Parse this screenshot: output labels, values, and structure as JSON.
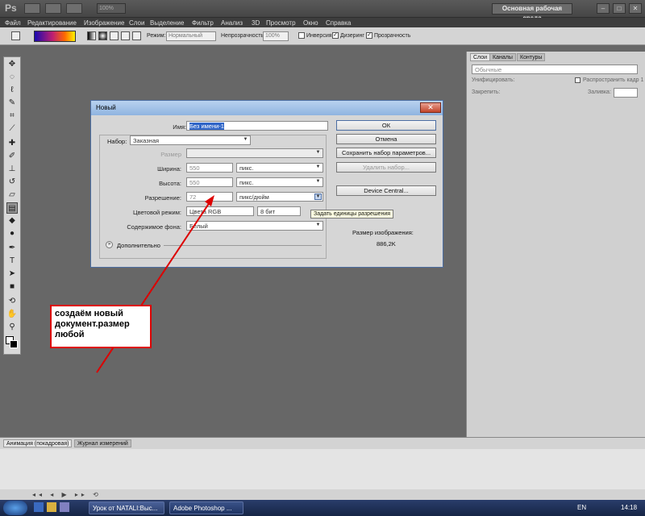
{
  "app": {
    "logo": "Ps",
    "zoom": "100%",
    "workspace": "Основная рабочая среда"
  },
  "menu": [
    "Файл",
    "Редактирование",
    "Изображение",
    "Слои",
    "Выделение",
    "Фильтр",
    "Анализ",
    "3D",
    "Просмотр",
    "Окно",
    "Справка"
  ],
  "window_controls": [
    "–",
    "□",
    "✕"
  ],
  "options": {
    "mode_label": "Режим:",
    "mode_value": "Нормальный",
    "opacity_label": "Непрозрачность:",
    "opacity_value": "100%",
    "invert": "Инверсия",
    "dither": "Дизеринг",
    "transparency": "Прозрачность"
  },
  "panel": {
    "tabs": [
      "Слои",
      "Каналы",
      "Контуры"
    ],
    "blend": "Обычные",
    "unify": "Унифицировать:",
    "propagate": "Распространить кадр 1",
    "lock": "Закрепить:",
    "fill": "Заливка:"
  },
  "bottom": {
    "tabs": [
      "Анимация (покадровая)",
      "Журнал измерений"
    ]
  },
  "dialog": {
    "title": "Новый",
    "name_label": "Имя:",
    "name_value": "Без имени-1",
    "preset_label": "Набор:",
    "preset_value": "Заказная",
    "size_label": "Размер",
    "width_label": "Ширина:",
    "width_value": "550",
    "width_unit": "пикс.",
    "height_label": "Высота:",
    "height_value": "550",
    "height_unit": "пикс.",
    "resolution_label": "Разрешение:",
    "resolution_value": "72",
    "resolution_unit": "пикс/дюйм",
    "colormode_label": "Цветовой режим:",
    "colormode_value": "Цвета RGB",
    "bits_value": "8 бит",
    "bg_label": "Содержимое фона:",
    "bg_value": "Белый",
    "advanced": "Дополнительно",
    "ok": "ОК",
    "cancel": "Отмена",
    "save_preset": "Сохранить набор параметров...",
    "delete_preset": "Удалить набор...",
    "device_central": "Device Central...",
    "image_size_label": "Размер изображения:",
    "image_size_value": "886,2K",
    "tooltip": "Задать единицы разрешения"
  },
  "annotation": "создаём новый документ.размер любой",
  "taskbar": {
    "items": [
      "Урок от NATALI:Выс...",
      "Adobe Photoshop ..."
    ],
    "lang": "EN",
    "time": "14:18"
  }
}
